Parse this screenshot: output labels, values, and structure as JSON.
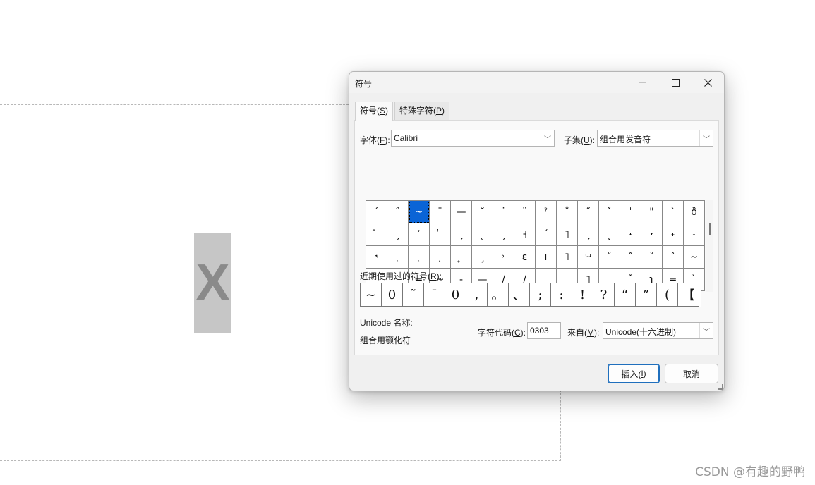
{
  "background": {
    "selected_char": "X",
    "watermark": "CSDN @有趣的野鸭"
  },
  "dialog": {
    "title": "符号",
    "tabs": [
      {
        "label": "符号(",
        "key": "S",
        "suffix": ")"
      },
      {
        "label": "特殊字符(",
        "key": "P",
        "suffix": ")"
      }
    ],
    "font_label": "字体(",
    "font_key": "F",
    "font_suffix": "):",
    "font_value": "Calibri",
    "subset_label": "子集(",
    "subset_key": "U",
    "subset_suffix": "):",
    "subset_value": "组合用发音符",
    "grid": [
      [
        "ˊ",
        "ˆ",
        "~",
        "¯",
        "—",
        "˘",
        "˙",
        "¨",
        "ˀ",
        "˚",
        "˝",
        "ˇ",
        "ˈ",
        "\"",
        "ˋ",
        "ȍ"
      ],
      [
        "̑",
        "ˏ",
        "̕",
        "̔",
        "ˏ",
        "ˎ",
        "ˏ",
        "˧",
        "ˊ",
        "˥",
        "ˏ",
        "˛",
        "˔",
        "˕",
        "˖",
        "˗"
      ],
      [
        "˞",
        "˛",
        "˛",
        "˛",
        "̥",
        "ˏ",
        "˒",
        "ɛ",
        "ı",
        "˥",
        "ᵚ",
        "˅",
        "˄",
        "˅",
        "˄",
        "~"
      ],
      [
        "_",
        "‗",
        "═",
        "~",
        "-",
        "—",
        "/",
        "/",
        "˛",
        "˽",
        "˥",
        "˯",
        "˟",
        "ʅ",
        "═",
        "ˋ"
      ]
    ],
    "selected_cell": "0-2",
    "recent_label": "近期使用过的符号(",
    "recent_key": "R",
    "recent_suffix": "):",
    "recent": [
      "~",
      "0",
      "˜",
      "¯",
      "0",
      ",",
      "。",
      "、",
      ";",
      ":",
      "!",
      "?",
      "“",
      "”",
      "(",
      "【"
    ],
    "unicode_name_label": "Unicode 名称:",
    "unicode_name_value": "组合用颚化符",
    "char_code_label": "字符代码(",
    "char_code_key": "C",
    "char_code_suffix": "):",
    "char_code_value": "0303",
    "from_label": "来自(",
    "from_key": "M",
    "from_suffix": "):",
    "from_value": "Unicode(十六进制)",
    "insert_label": "插入(",
    "insert_key": "I",
    "insert_suffix": ")",
    "cancel_label": "取消"
  },
  "colors": {
    "selection": "#0a64d6",
    "default_button_border": "#1f6fbd"
  }
}
